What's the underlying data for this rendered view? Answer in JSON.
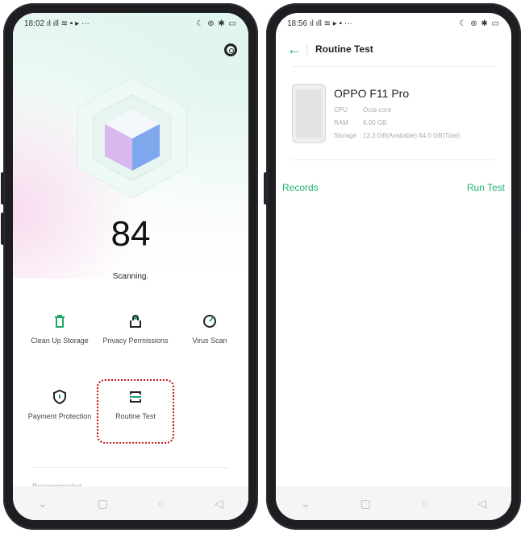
{
  "left_phone": {
    "status": {
      "time": "18:02",
      "icons_left": "ıl ıll ≋ ▪ ▸ ···",
      "icons_right": "☾ ⊚ ✱ ▭"
    },
    "score": "84",
    "scan_status": "Scanning.",
    "tools": [
      {
        "label": "Clean Up Storage",
        "icon": "trash-icon"
      },
      {
        "label": "Privacy Permissions",
        "icon": "lock-icon"
      },
      {
        "label": "Virus Scan",
        "icon": "gauge-icon"
      },
      {
        "label": "Payment Protection",
        "icon": "shield-icon"
      },
      {
        "label": "Routine Test",
        "icon": "routine-test-icon"
      }
    ],
    "recommended_label": "Recommended"
  },
  "right_phone": {
    "status": {
      "time": "18:56",
      "icons_left": "ıl ıll ≋ ▸ ▪ ···",
      "icons_right": "☾ ⊚ ✱ ▭"
    },
    "title": "Routine Test",
    "device": {
      "name": "OPPO F11 Pro",
      "specs": [
        {
          "key": "CPU",
          "value": "Octa-core"
        },
        {
          "key": "RAM",
          "value": "6.00 GB"
        },
        {
          "key": "Storage",
          "value": "12.3 GB(Available) 64.0 GB(Total)"
        }
      ]
    },
    "records_label": "Records",
    "run_test_label": "Run Test"
  },
  "colors": {
    "accent": "#22b573",
    "highlight": "#cc1111"
  }
}
